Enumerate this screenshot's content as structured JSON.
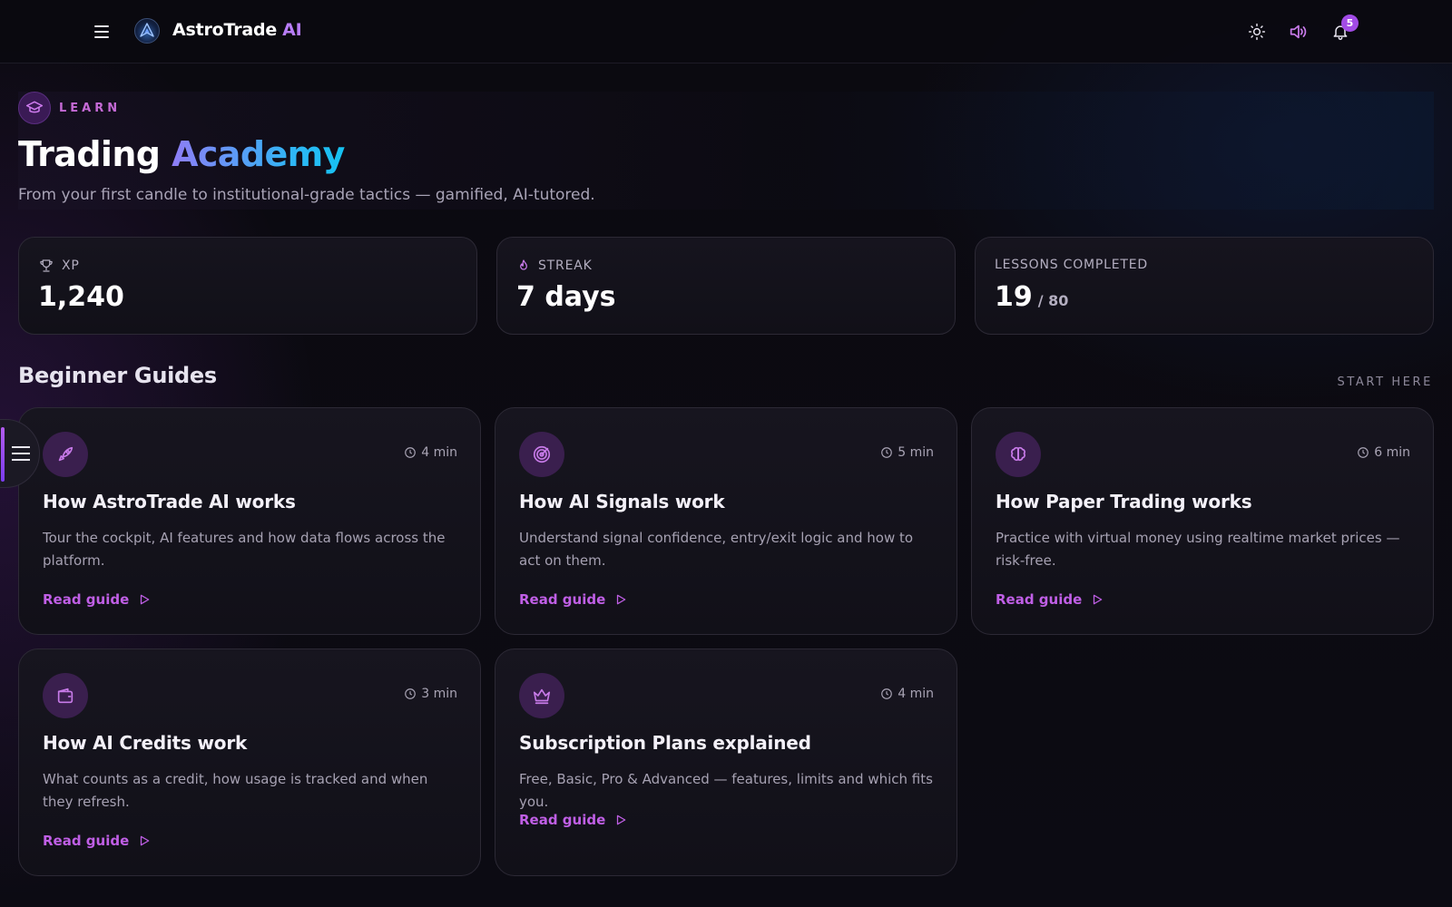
{
  "app": {
    "brand_name": "AstroTrade",
    "brand_suffix": "AI",
    "notifications_count": "5"
  },
  "hero": {
    "eyebrow": "LEARN",
    "title_main": "Trading",
    "title_accent": "Academy",
    "subtitle": "From your first candle to institutional-grade tactics — gamified, AI-tutored."
  },
  "stats": [
    {
      "label": "XP",
      "value": "1,240",
      "sub": "",
      "icon": "trophy-icon"
    },
    {
      "label": "STREAK",
      "value": "7 days",
      "sub": "",
      "icon": "flame-icon"
    },
    {
      "label": "LESSONS COMPLETED",
      "value": "19",
      "sub": "/ 80",
      "icon": ""
    }
  ],
  "section": {
    "title": "Beginner Guides",
    "link_label": "START HERE"
  },
  "guides": [
    {
      "icon": "rocket-icon",
      "duration": "4 min",
      "title": "How AstroTrade AI works",
      "description": "Tour the cockpit, AI features and how data flows across the platform.",
      "cta": "Read guide"
    },
    {
      "icon": "radar-icon",
      "duration": "5 min",
      "title": "How AI Signals work",
      "description": "Understand signal confidence, entry/exit logic and how to act on them.",
      "cta": "Read guide"
    },
    {
      "icon": "brain-icon",
      "duration": "6 min",
      "title": "How Paper Trading works",
      "description": "Practice with virtual money using realtime market prices — risk-free.",
      "cta": "Read guide"
    },
    {
      "icon": "wallet-icon",
      "duration": "3 min",
      "title": "How AI Credits work",
      "description": "What counts as a credit, how usage is tracked and when they refresh.",
      "cta": "Read guide"
    },
    {
      "icon": "crown-icon",
      "duration": "4 min",
      "title": "Subscription Plans explained",
      "description": "Free, Basic, Pro & Advanced — features, limits and which fits you.",
      "cta": "Read guide"
    }
  ],
  "colors": {
    "accent": "#c05fe6",
    "icon_purple": "#c77ae8",
    "background": "#0b0a12"
  }
}
